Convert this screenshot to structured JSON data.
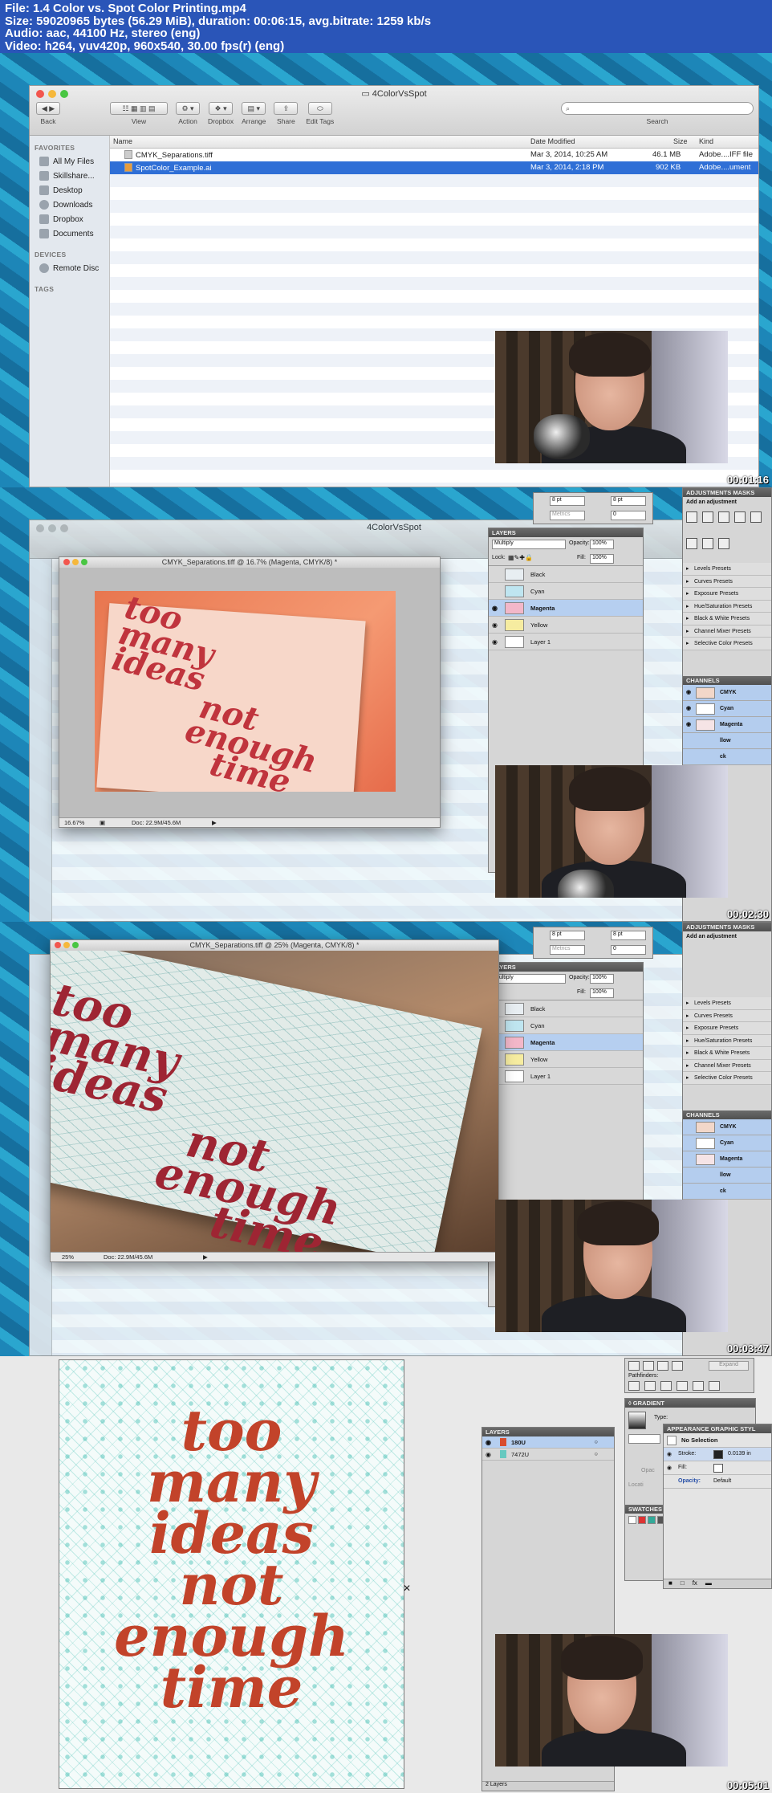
{
  "header": {
    "line1": "File: 1.4 Color vs. Spot Color Printing.mp4",
    "line2": "Size: 59020965 bytes (56.29 MiB), duration: 00:06:15, avg.bitrate: 1259 kb/s",
    "line3": "Audio: aac, 44100 Hz, stereo (eng)",
    "line4": "Video: h264, yuv420p, 960x540, 30.00 fps(r) (eng)"
  },
  "timestamps": [
    "00:01:16",
    "00:02:30",
    "00:03:47",
    "00:05:01"
  ],
  "finder": {
    "title": "4ColorVsSpot",
    "toolbar": {
      "back": "Back",
      "view": "View",
      "action": "Action",
      "dropbox": "Dropbox",
      "arrange": "Arrange",
      "share": "Share",
      "edit_tags": "Edit Tags",
      "search": "Search"
    },
    "sidebar": {
      "favorites_heading": "FAVORITES",
      "favorites": [
        "All My Files",
        "Skillshare...",
        "Desktop",
        "Downloads",
        "Dropbox",
        "Documents"
      ],
      "devices_heading": "DEVICES",
      "devices": [
        "Remote Disc"
      ],
      "tags_heading": "TAGS"
    },
    "columns": {
      "name": "Name",
      "date": "Date Modified",
      "size": "Size",
      "kind": "Kind"
    },
    "files": [
      {
        "name": "CMYK_Separations.tiff",
        "date": "Mar 3, 2014, 10:25 AM",
        "size": "46.1 MB",
        "kind": "Adobe....IFF file"
      },
      {
        "name": "SpotColor_Example.ai",
        "date": "Mar 3, 2014, 2:18 PM",
        "size": "902 KB",
        "kind": "Adobe....ument"
      }
    ]
  },
  "ps": {
    "doc1_title": "CMYK_Separations.tiff @ 16.7% (Magenta, CMYK/8) *",
    "doc1_zoom": "16.67%",
    "doc2_title": "CMYK_Separations.tiff @ 25% (Magenta, CMYK/8) *",
    "doc2_zoom": "25%",
    "doc_size": "Doc: 22.9M/45.6M",
    "card_text": [
      "too",
      "many",
      "ideas",
      "not",
      "enough",
      "time"
    ],
    "colors": {
      "card_red": "#c0343d",
      "card_bg_orange": "#e06a4a",
      "accent_blue": "#b6cff0"
    },
    "layers_panel": {
      "title": "LAYERS",
      "blend": "Multiply",
      "opacity_label": "Opacity:",
      "opacity": "100%",
      "lock_label": "Lock:",
      "fill_label": "Fill:",
      "fill": "100%",
      "layers": [
        "Black",
        "Cyan",
        "Magenta",
        "Yellow",
        "Layer 1"
      ]
    },
    "char_fields": [
      "8 pt",
      "8 pt",
      "Metrics",
      "0"
    ],
    "adjustments": {
      "tabs": "ADJUSTMENTS  MASKS",
      "add": "Add an adjustment",
      "presets": [
        "Levels Presets",
        "Curves Presets",
        "Exposure Presets",
        "Hue/Saturation Presets",
        "Black & White Presets",
        "Channel Mixer Presets",
        "Selective Color Presets"
      ]
    },
    "channels": {
      "title": "CHANNELS",
      "items": [
        "CMYK",
        "Cyan",
        "Magenta",
        "llow",
        "ck"
      ]
    }
  },
  "ai": {
    "layers_title": "LAYERS",
    "layers": [
      "180U",
      "7472U"
    ],
    "layers_count": "2 Layers",
    "pathfinders": "Pathfinders:",
    "expand": "Expand",
    "gradient_title": "GRADIENT",
    "type_label": "Type:",
    "appearance_tabs": "APPEARANCE  GRAPHIC STYL",
    "no_selection": "No Selection",
    "stroke_label": "Stroke:",
    "stroke_value": "0.0139 in",
    "fill_label": "Fill:",
    "opacity_label": "Opacity:",
    "opacity_value": "Default",
    "swatches_title": "SWATCHES",
    "location": "Locati",
    "opac": "Opac",
    "text_color": "#c2432a"
  }
}
